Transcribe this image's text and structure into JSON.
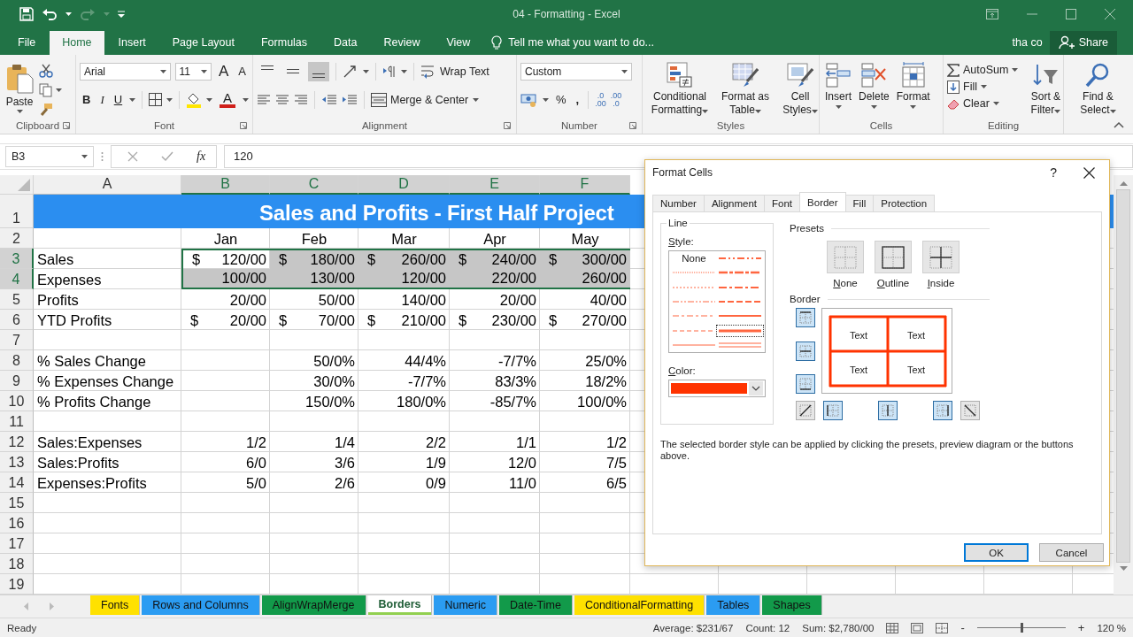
{
  "window": {
    "title": "04 - Formatting - Excel"
  },
  "ribbon_tabs": [
    {
      "label": "File",
      "selected": false
    },
    {
      "label": "Home",
      "selected": true
    },
    {
      "label": "Insert",
      "selected": false
    },
    {
      "label": "Page Layout",
      "selected": false
    },
    {
      "label": "Formulas",
      "selected": false
    },
    {
      "label": "Data",
      "selected": false
    },
    {
      "label": "Review",
      "selected": false
    },
    {
      "label": "View",
      "selected": false
    }
  ],
  "tell_me": {
    "placeholder": "Tell me what you want to do..."
  },
  "user": "tha co",
  "share": "Share",
  "ribbon": {
    "clipboard": {
      "paste": "Paste",
      "label": "Clipboard"
    },
    "font": {
      "name": "Arial",
      "size": "11",
      "grow": "A",
      "shrink": "A",
      "bold": "B",
      "italic": "I",
      "underline": "U",
      "font_color": "A",
      "label": "Font"
    },
    "alignment": {
      "valign": [
        {
          "selected": false
        },
        {
          "selected": false
        },
        {
          "selected": true
        }
      ],
      "wrap_text": "Wrap Text",
      "merge": "Merge & Center",
      "label": "Alignment"
    },
    "number": {
      "format": "Custom",
      "percent": "%",
      "comma": ",",
      "increase_decimal": [
        ".0",
        ".00"
      ],
      "decrease_decimal": [
        ".00",
        ".0"
      ],
      "label": "Number"
    },
    "styles": {
      "buttons": [
        {
          "kind": "conditional",
          "label": "Conditional Formatting"
        },
        {
          "kind": "table",
          "label": "Format as Table"
        },
        {
          "kind": "cellstyles",
          "label": "Cell Styles"
        }
      ],
      "label": "Styles"
    },
    "cells": {
      "buttons": [
        {
          "kind": "insert",
          "label": "Insert"
        },
        {
          "kind": "delete",
          "label": "Delete"
        },
        {
          "kind": "format",
          "label": "Format"
        }
      ],
      "label": "Cells"
    },
    "editing": {
      "autosum": "AutoSum",
      "fill": "Fill",
      "clear": "Clear",
      "sort": "Sort & Filter",
      "find": "Find & Select",
      "label": "Editing"
    }
  },
  "formula_bar": {
    "name_box": "B3",
    "fx": "fx",
    "value": "120"
  },
  "sheet": {
    "columns": [
      {
        "label": "A",
        "selected": false
      },
      {
        "label": "B",
        "selected": true
      },
      {
        "label": "C",
        "selected": true
      },
      {
        "label": "D",
        "selected": true
      },
      {
        "label": "E",
        "selected": true
      },
      {
        "label": "F",
        "selected": true
      }
    ],
    "rows": [
      {
        "n": "1",
        "kind": "title",
        "selected": false,
        "title": "Sales and Profits - First Half Project"
      },
      {
        "n": "2",
        "kind": "header",
        "selected": false,
        "cells": [
          null,
          "Jan",
          "Feb",
          "Mar",
          "Apr",
          "May"
        ]
      },
      {
        "n": "3",
        "kind": "data",
        "selected": true,
        "cells": [
          "Sales",
          {
            "sym": "$",
            "v": "120/00",
            "selected": false
          },
          {
            "sym": "$",
            "v": "180/00",
            "selected": true
          },
          {
            "sym": "$",
            "v": "260/00",
            "selected": true
          },
          {
            "sym": "$",
            "v": "240/00",
            "selected": true
          },
          {
            "sym": "$",
            "v": "300/00",
            "selected": true
          }
        ]
      },
      {
        "n": "4",
        "kind": "data",
        "selected": true,
        "cells": [
          "Expenses",
          {
            "v": "100/00",
            "selected": true
          },
          {
            "v": "130/00",
            "selected": true
          },
          {
            "v": "120/00",
            "selected": true
          },
          {
            "v": "220/00",
            "selected": true
          },
          {
            "v": "260/00",
            "selected": true
          }
        ]
      },
      {
        "n": "5",
        "kind": "data",
        "selected": false,
        "cells": [
          "Profits",
          "20/00",
          "50/00",
          "140/00",
          "20/00",
          "40/00"
        ]
      },
      {
        "n": "6",
        "kind": "data",
        "selected": false,
        "cells": [
          "YTD Profits",
          {
            "sym": "$",
            "v": "20/00",
            "selected": false
          },
          {
            "sym": "$",
            "v": "70/00",
            "selected": false
          },
          {
            "sym": "$",
            "v": "210/00",
            "selected": false
          },
          {
            "sym": "$",
            "v": "230/00",
            "selected": false
          },
          {
            "sym": "$",
            "v": "270/00",
            "selected": false
          }
        ]
      },
      {
        "n": "7",
        "kind": "data",
        "selected": false
      },
      {
        "n": "8",
        "kind": "data",
        "selected": false,
        "cells": [
          "% Sales Change",
          null,
          "50/0%",
          "44/4%",
          "-7/7%",
          "25/0%"
        ]
      },
      {
        "n": "9",
        "kind": "data",
        "selected": false,
        "cells": [
          "% Expenses Change",
          null,
          "30/0%",
          "-7/7%",
          "83/3%",
          "18/2%"
        ]
      },
      {
        "n": "10",
        "kind": "data",
        "selected": false,
        "cells": [
          "% Profits Change",
          null,
          "150/0%",
          "180/0%",
          "-85/7%",
          "100/0%"
        ]
      },
      {
        "n": "11",
        "kind": "data",
        "selected": false
      },
      {
        "n": "12",
        "kind": "data",
        "selected": false,
        "cells": [
          "Sales:Expenses",
          "1/2",
          "1/4",
          "2/2",
          "1/1",
          "1/2"
        ]
      },
      {
        "n": "13",
        "kind": "data",
        "selected": false,
        "cells": [
          "Sales:Profits",
          "6/0",
          "3/6",
          "1/9",
          "12/0",
          "7/5"
        ]
      },
      {
        "n": "14",
        "kind": "data",
        "selected": false,
        "cells": [
          "Expenses:Profits",
          "5/0",
          "2/6",
          "0/9",
          "11/0",
          "6/5"
        ]
      },
      {
        "n": "15",
        "kind": "data",
        "selected": false
      },
      {
        "n": "16",
        "kind": "data",
        "selected": false
      },
      {
        "n": "17",
        "kind": "data",
        "selected": false
      },
      {
        "n": "18",
        "kind": "data",
        "selected": false
      },
      {
        "n": "19",
        "kind": "data",
        "selected": false
      }
    ]
  },
  "sheet_tabs": [
    {
      "label": "Fonts",
      "color": "#ffe100",
      "selected": false
    },
    {
      "label": "Rows and Columns",
      "color": "#2b9cf2",
      "selected": false
    },
    {
      "label": "AlignWrapMerge",
      "color": "#129a4a",
      "selected": false
    },
    {
      "label": "Borders",
      "color": "#92d050",
      "selected": true
    },
    {
      "label": "Numeric",
      "color": "#2b9cf2",
      "selected": false
    },
    {
      "label": "Date-Time",
      "color": "#129a4a",
      "selected": false
    },
    {
      "label": "ConditionalFormatting",
      "color": "#ffe100",
      "selected": false
    },
    {
      "label": "Tables",
      "color": "#2b9cf2",
      "selected": false
    },
    {
      "label": "Shapes",
      "color": "#129a4a",
      "selected": false
    }
  ],
  "status_bar": {
    "ready": "Ready",
    "average": "Average: $231/67",
    "count": "Count: 12",
    "sum": "Sum: $2,780/00",
    "minus": "-",
    "plus": "+",
    "zoom_slider": {
      "level": 0.5
    },
    "zoom": "120 %"
  },
  "dialog": {
    "title": "Format Cells",
    "help": "?",
    "tabs": [
      {
        "label": "Number",
        "selected": false
      },
      {
        "label": "Alignment",
        "selected": false
      },
      {
        "label": "Font",
        "selected": false
      },
      {
        "label": "Border",
        "selected": true
      },
      {
        "label": "Fill",
        "selected": false
      },
      {
        "label": "Protection",
        "selected": false
      }
    ],
    "line_label": "Line",
    "style_label": "Style:",
    "styles": [
      {
        "kind": "none",
        "label": "None",
        "selected": false
      },
      {
        "kind": "hair",
        "selected": false
      },
      {
        "kind": "dotted",
        "selected": false
      },
      {
        "kind": "dashdotdot",
        "selected": false
      },
      {
        "kind": "dashdot",
        "selected": false
      },
      {
        "kind": "dashed",
        "selected": false
      },
      {
        "kind": "thin",
        "selected": false
      },
      {
        "kind": "mediumdashdotdot",
        "selected": false
      },
      {
        "kind": "slantdashdot",
        "selected": false
      },
      {
        "kind": "mediumdashdot",
        "selected": false
      },
      {
        "kind": "mediumdashed",
        "selected": false
      },
      {
        "kind": "medium",
        "selected": false
      },
      {
        "kind": "thick",
        "selected": true
      },
      {
        "kind": "double",
        "selected": false
      }
    ],
    "color_label": "Color:",
    "color": "#ff3300",
    "presets_label": "Presets",
    "presets": [
      {
        "kind": "none",
        "label": "None"
      },
      {
        "kind": "outline",
        "label": "Outline"
      },
      {
        "kind": "inside",
        "label": "Inside"
      }
    ],
    "border_label": "Border",
    "border_buttons": [
      {
        "kind": "top",
        "on": true
      },
      {
        "kind": "middle",
        "on": true
      },
      {
        "kind": "bottom",
        "on": true
      },
      {
        "kind": "diag_up",
        "on": false
      },
      {
        "kind": "left",
        "on": true
      },
      {
        "kind": "center",
        "on": true
      },
      {
        "kind": "right",
        "on": true
      },
      {
        "kind": "diag_down",
        "on": false
      }
    ],
    "preview_text": [
      "Text",
      "Text",
      "Text",
      "Text"
    ],
    "hint": "The selected border style can be applied by clicking the presets, preview diagram or the buttons above.",
    "ok": "OK",
    "cancel": "Cancel"
  }
}
